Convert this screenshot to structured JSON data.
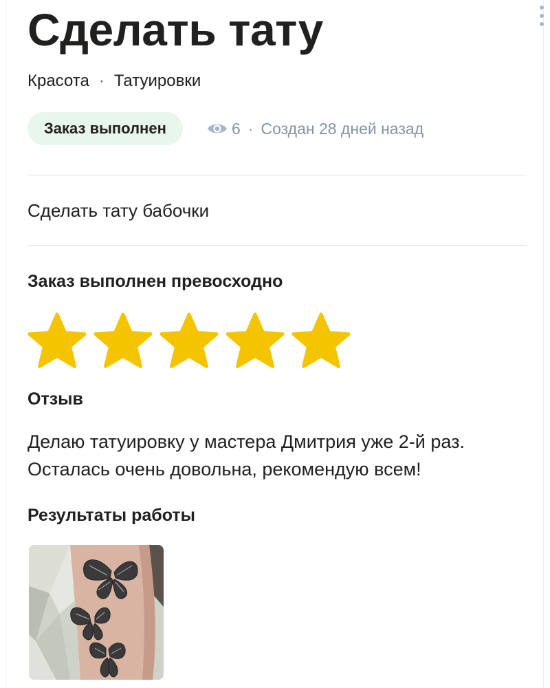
{
  "order": {
    "title": "Сделать тату",
    "category": "Красота",
    "subcategory": "Татуировки",
    "crumb_separator": "·",
    "status": "Заказ выполнен",
    "views": "6",
    "meta_separator": "·",
    "created": "Создан 28 дней назад",
    "description": "Сделать тату бабочки"
  },
  "rating": {
    "heading": "Заказ выполнен превосходно",
    "stars": 5,
    "max_stars": 5,
    "star_color": "#f5c400"
  },
  "review": {
    "heading": "Отзыв",
    "text": "Делаю татуировку у мастера Дмитрия уже 2-й раз. Осталась очень довольна, рекомендую всем!"
  },
  "results": {
    "heading": "Результаты работы",
    "photos": [
      "butterfly-tattoo-photo"
    ]
  },
  "icons": {
    "menu": "more-vertical-icon",
    "views": "eye-icon"
  },
  "colors": {
    "badge_bg": "#e9f6ec",
    "meta_text": "#8295a6",
    "menu_dots": "#a9b7c4"
  }
}
